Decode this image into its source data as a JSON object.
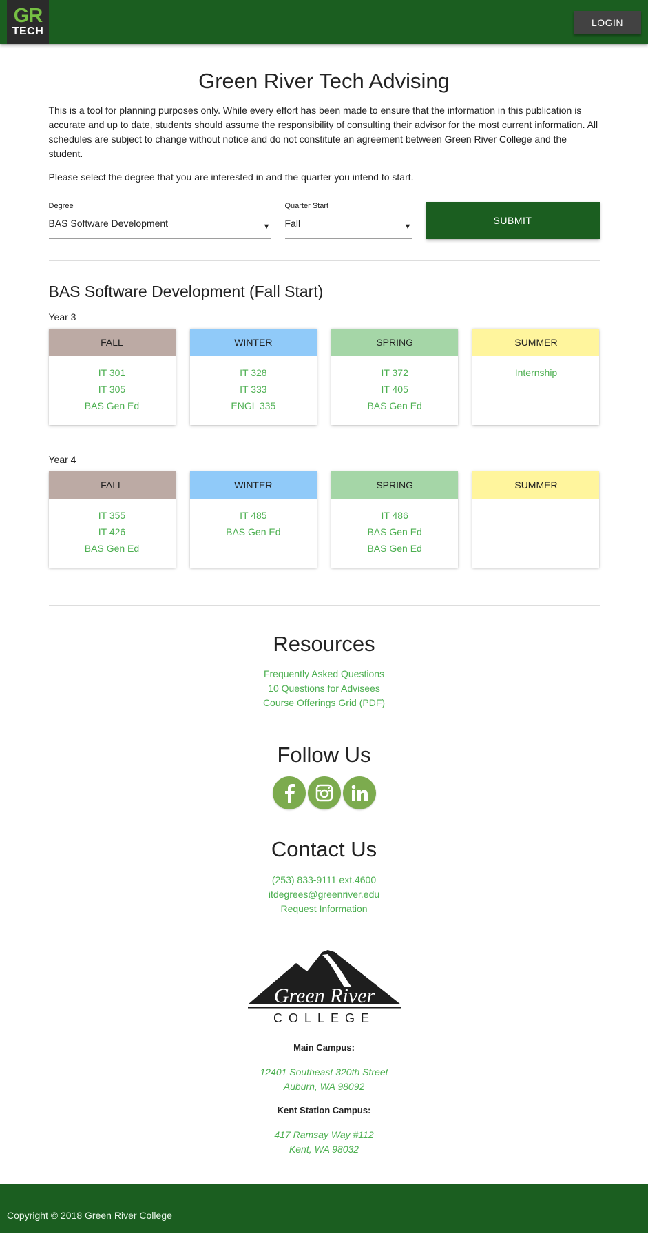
{
  "header": {
    "logo_top": "GR",
    "logo_bottom": "TECH",
    "login_label": "LOGIN"
  },
  "page": {
    "title": "Green River Tech Advising",
    "intro": "This is a tool for planning purposes only. While every effort has been made to ensure that the information in this publication is accurate and up to date, students should assume the responsibility of consulting their advisor for the most current information. All schedules are subject to change without notice and do not constitute an agreement between Green River College and the student.",
    "instruction": "Please select the degree that you are interested in and the quarter you intend to start."
  },
  "form": {
    "degree_label": "Degree",
    "degree_value": "BAS Software Development",
    "quarter_label": "Quarter Start",
    "quarter_value": "Fall",
    "submit_label": "SUBMIT"
  },
  "plan": {
    "title": "BAS Software Development (Fall Start)",
    "years": [
      {
        "label": "Year 3",
        "quarters": [
          {
            "name": "FALL",
            "courses": [
              "IT 301",
              "IT 305",
              "BAS Gen Ed"
            ]
          },
          {
            "name": "WINTER",
            "courses": [
              "IT 328",
              "IT 333",
              "ENGL 335"
            ]
          },
          {
            "name": "SPRING",
            "courses": [
              "IT 372",
              "IT 405",
              "BAS Gen Ed"
            ]
          },
          {
            "name": "SUMMER",
            "courses": [
              "Internship"
            ]
          }
        ]
      },
      {
        "label": "Year 4",
        "quarters": [
          {
            "name": "FALL",
            "courses": [
              "IT 355",
              "IT 426",
              "BAS Gen Ed"
            ]
          },
          {
            "name": "WINTER",
            "courses": [
              "IT 485",
              "BAS Gen Ed"
            ]
          },
          {
            "name": "SPRING",
            "courses": [
              "IT 486",
              "BAS Gen Ed",
              "BAS Gen Ed"
            ]
          },
          {
            "name": "SUMMER",
            "courses": []
          }
        ]
      }
    ]
  },
  "resources": {
    "title": "Resources",
    "links": [
      "Frequently Asked Questions",
      "10 Questions for Advisees",
      "Course Offerings Grid (PDF)"
    ]
  },
  "follow": {
    "title": "Follow Us",
    "icons": [
      "facebook-icon",
      "instagram-icon",
      "linkedin-icon"
    ]
  },
  "contact": {
    "title": "Contact Us",
    "phone": "(253) 833-9111 ext.4600",
    "email": "itdegrees@greenriver.edu",
    "request": "Request Information"
  },
  "college": {
    "logo_name": "Green River",
    "logo_sub": "COLLEGE",
    "main_campus_label": "Main Campus:",
    "main_campus_line1": "12401 Southeast 320th Street",
    "main_campus_line2": "Auburn, WA 98092",
    "kent_campus_label": "Kent Station Campus:",
    "kent_campus_line1": "417 Ramsay Way #112",
    "kent_campus_line2": "Kent, WA 98032"
  },
  "footer": {
    "copyright": "Copyright © 2018 Green River College"
  },
  "colors": {
    "brand_green": "#1b5e20",
    "link_green": "#4caf50",
    "fall": "#bcaaa4",
    "winter": "#90caf9",
    "spring": "#a5d6a7",
    "summer": "#fff59d"
  }
}
